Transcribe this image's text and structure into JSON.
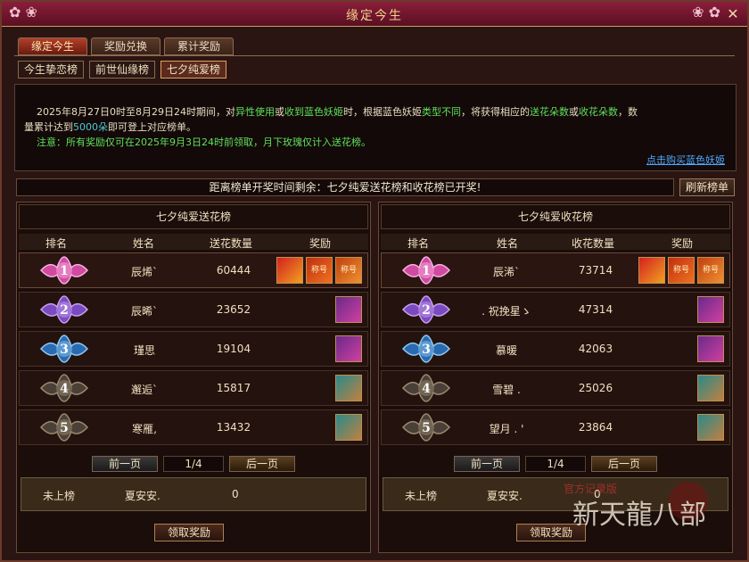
{
  "window": {
    "title": "缘定今生"
  },
  "main_tabs": [
    {
      "label": "缘定今生",
      "active": true
    },
    {
      "label": "奖励兑换",
      "active": false
    },
    {
      "label": "累计奖励",
      "active": false
    }
  ],
  "sub_tabs": [
    {
      "label": "今生挚恋榜",
      "active": false
    },
    {
      "label": "前世仙缘榜",
      "active": false
    },
    {
      "label": "七夕纯爱榜",
      "active": true
    }
  ],
  "info": {
    "p1_a": "2025年8月27日0时至8月29日24时期间，对",
    "p1_b": "异性使用",
    "p1_c": "或",
    "p1_d": "收到蓝色妖姬",
    "p1_e": "时，根据蓝色妖姬",
    "p1_f": "类型不同",
    "p1_g": "，将获得相应的",
    "p1_h": "送花朵数",
    "p1_i": "或",
    "p1_j": "收花朵数",
    "p1_k": "，数",
    "p2_a": "量累计达到",
    "p2_b": "5000朵",
    "p2_c": "即可登上对应榜单。",
    "p3": "注意：所有奖励仅可在2025年9月3日24时前领取，月下玫瑰仅计入送花榜。",
    "buy_link": "点击购买蓝色妖姬"
  },
  "countdown": "距离榜单开奖时间剩余：七夕纯爱送花榜和收花榜已开奖!",
  "refresh_label": "刷新榜单",
  "left": {
    "title": "七夕纯爱送花榜",
    "headers": {
      "rank": "排名",
      "name": "姓名",
      "score": "送花数量",
      "reward": "奖励"
    },
    "rows": [
      {
        "rank": "1",
        "name": "辰烯`",
        "score": "60444"
      },
      {
        "rank": "2",
        "name": "辰晞`",
        "score": "23652"
      },
      {
        "rank": "3",
        "name": "瑾思",
        "score": "19104"
      },
      {
        "rank": "4",
        "name": "邂逅`",
        "score": "15817"
      },
      {
        "rank": "5",
        "name": "寒雁,",
        "score": "13432"
      }
    ],
    "pager": {
      "prev": "前一页",
      "page": "1/4",
      "next": "后一页"
    },
    "mine": {
      "status": "未上榜",
      "name": "夏安安.",
      "score": "0"
    },
    "claim": "领取奖励"
  },
  "right": {
    "title": "七夕纯爱收花榜",
    "headers": {
      "rank": "排名",
      "name": "姓名",
      "score": "收花数量",
      "reward": "奖励"
    },
    "rows": [
      {
        "rank": "1",
        "name": "辰浠`",
        "score": "73714"
      },
      {
        "rank": "2",
        "name": ". 祝挽星ゝ",
        "score": "47314"
      },
      {
        "rank": "3",
        "name": "慕暖",
        "score": "42063"
      },
      {
        "rank": "4",
        "name": "雪碧 .",
        "score": "25026"
      },
      {
        "rank": "5",
        "name": "望月 . '",
        "score": "23864"
      }
    ],
    "pager": {
      "prev": "前一页",
      "page": "1/4",
      "next": "后一页"
    },
    "mine": {
      "status": "未上榜",
      "name": "夏安安.",
      "score": "0"
    },
    "claim": "领取奖励"
  },
  "reward_tags": {
    "tag1": "称号",
    "tag2": "称号"
  },
  "logo": {
    "line1": "官方记录版",
    "line2": "新天龍八部"
  }
}
